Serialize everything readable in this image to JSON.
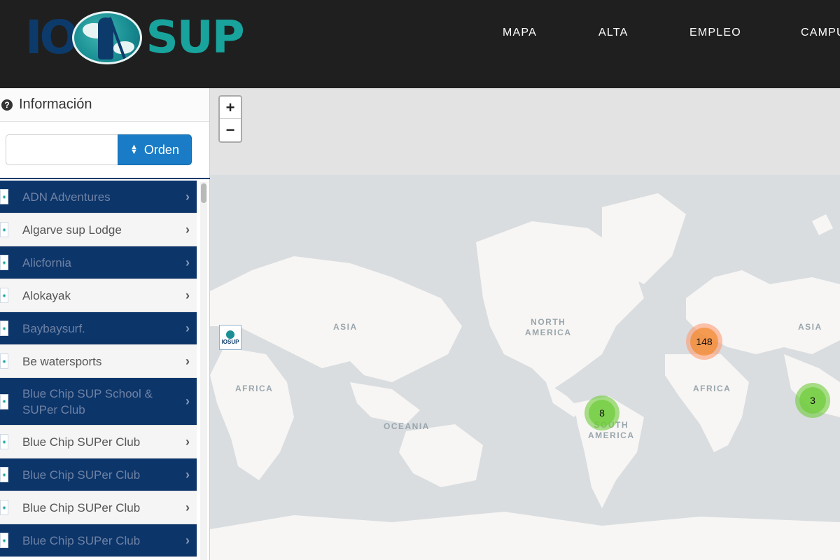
{
  "brand": {
    "io": "IO",
    "sup": "SUP"
  },
  "nav": [
    {
      "label": "MAPA"
    },
    {
      "label": "ALTA"
    },
    {
      "label": "EMPLEO"
    },
    {
      "label": "CAMPU"
    }
  ],
  "sidebar": {
    "title": "Información",
    "search_value": "",
    "order_label": "Orden",
    "items": [
      {
        "label": "ADN Adventures",
        "style": "dark"
      },
      {
        "label": "Algarve sup Lodge",
        "style": "light"
      },
      {
        "label": "Alicfornia",
        "style": "dark"
      },
      {
        "label": "Alokayak",
        "style": "light"
      },
      {
        "label": "Baybaysurf.",
        "style": "dark"
      },
      {
        "label": "Be watersports",
        "style": "light"
      },
      {
        "label": "Blue Chip SUP School & SUPer Club",
        "style": "dark"
      },
      {
        "label": "Blue Chip SUPer Club",
        "style": "light"
      },
      {
        "label": "Blue Chip SUPer Club",
        "style": "dark"
      },
      {
        "label": "Blue Chip SUPer Club",
        "style": "light"
      },
      {
        "label": "Blue Chip SUPer Club",
        "style": "dark"
      }
    ]
  },
  "map": {
    "zoom_in": "+",
    "zoom_out": "−",
    "marker_text": "IOSUP",
    "clusters": [
      {
        "count": "148",
        "color": "orange"
      },
      {
        "count": "8",
        "color": "green"
      },
      {
        "count": "3",
        "color": "green"
      }
    ],
    "labels": [
      "ASIA",
      "NORTH\nAMERICA",
      "AFRICA",
      "OCEANIA",
      "SOUTH\nAMERICA",
      "AFRICA",
      "ASIA"
    ]
  }
}
